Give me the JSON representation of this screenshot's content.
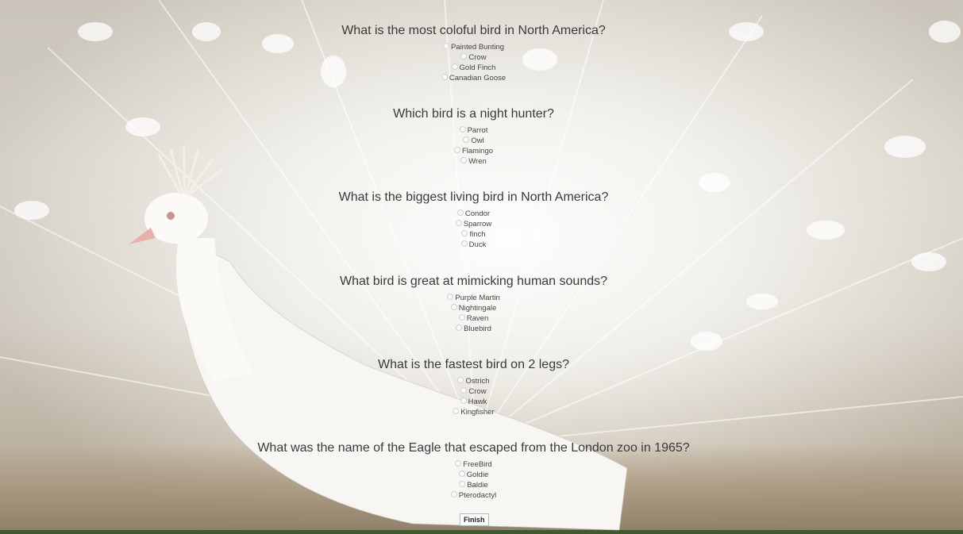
{
  "questions": [
    {
      "text": "What is the most coloful bird in North America?",
      "options": [
        "Painted Bunting",
        "Crow",
        "Gold Finch",
        "Canadian Goose"
      ]
    },
    {
      "text": "Which bird is a night hunter?",
      "options": [
        "Parrot",
        "Owl",
        "Flamingo",
        "Wren"
      ]
    },
    {
      "text": "What is the biggest living bird in North America?",
      "options": [
        "Condor",
        "Sparrow",
        "finch",
        "Duck"
      ]
    },
    {
      "text": "What bird is great at mimicking human sounds?",
      "options": [
        "Purple Martin",
        "Nightingale",
        "Raven",
        "Bluebird"
      ]
    },
    {
      "text": "What is the fastest bird on 2 legs?",
      "options": [
        "Ostrich",
        "Crow",
        "Hawk",
        "Kingfisher"
      ]
    },
    {
      "text": "What was the name of the Eagle that escaped from the London zoo in 1965?",
      "options": [
        "FreeBird",
        "Goldie",
        "Baldie",
        "Pterodactyl"
      ]
    }
  ],
  "finish_label": "Finish",
  "colors": {
    "text": "#333333",
    "background_tone": "#e8e6e1",
    "ground": "#9d8c76"
  }
}
